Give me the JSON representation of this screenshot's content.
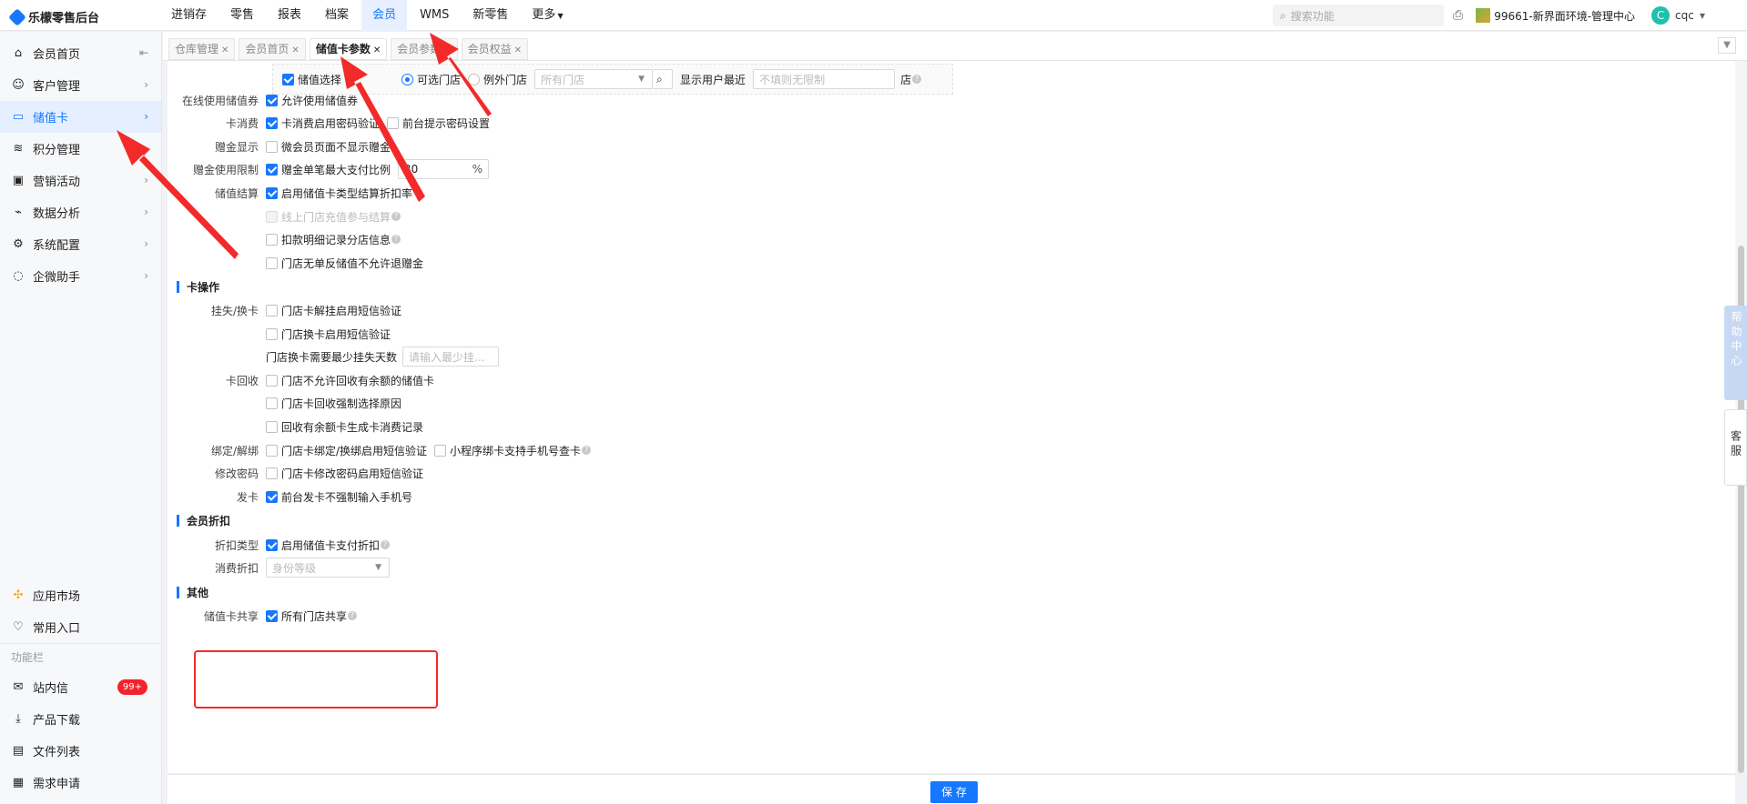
{
  "app": {
    "title": "乐檬零售后台"
  },
  "topnav": {
    "items": [
      "进销存",
      "零售",
      "报表",
      "档案",
      "会员",
      "WMS",
      "新零售",
      "更多"
    ],
    "active": "会员",
    "search_placeholder": "搜索功能",
    "store": "99661-新界面环境-管理中心",
    "user_initial": "C",
    "user": "cqc"
  },
  "sidebar": {
    "items": [
      {
        "label": "会员首页",
        "icon": "home-icon"
      },
      {
        "label": "客户管理",
        "icon": "user-icon"
      },
      {
        "label": "储值卡",
        "icon": "card-icon",
        "active": true
      },
      {
        "label": "积分管理",
        "icon": "database-icon"
      },
      {
        "label": "营销活动",
        "icon": "campaign-icon"
      },
      {
        "label": "数据分析",
        "icon": "chart-icon"
      },
      {
        "label": "系统配置",
        "icon": "gear-icon"
      },
      {
        "label": "企微助手",
        "icon": "chat-icon"
      }
    ],
    "bottom_items": [
      {
        "label": "应用市场",
        "icon": "app-market-icon"
      },
      {
        "label": "常用入口",
        "icon": "heart-icon"
      }
    ],
    "section_title": "功能栏",
    "tool_items": [
      {
        "label": "站内信",
        "icon": "mail-icon",
        "badge": "99+"
      },
      {
        "label": "产品下载",
        "icon": "download-icon"
      },
      {
        "label": "文件列表",
        "icon": "file-icon"
      },
      {
        "label": "需求申请",
        "icon": "request-icon"
      }
    ]
  },
  "tabs": [
    {
      "label": "仓库管理",
      "active": false
    },
    {
      "label": "会员首页",
      "active": false
    },
    {
      "label": "储值卡参数",
      "active": true
    },
    {
      "label": "会员参数",
      "active": false
    },
    {
      "label": "会员权益",
      "active": false
    }
  ],
  "form": {
    "top_row": {
      "checkbox_label": "储值选择",
      "radio1": "可选门店",
      "radio2": "例外门店",
      "store_select_placeholder": "所有门店",
      "recent_label": "显示用户最近",
      "recent_placeholder": "不填则无限制",
      "suffix": "店"
    },
    "online_coupon": {
      "label": "在线使用储值券",
      "option": "允许使用储值券"
    },
    "card_consume": {
      "label": "卡消费",
      "option1": "卡消费启用密码验证",
      "option2": "前台提示密码设置"
    },
    "gift_display": {
      "label": "赠金显示",
      "option": "微会员页面不显示赠金"
    },
    "gift_limit": {
      "label": "赠金使用限制",
      "option": "赠金单笔最大支付比例",
      "value": "30",
      "unit": "%"
    },
    "settle": {
      "label": "储值结算",
      "option1": "启用储值卡类型结算折扣率",
      "option2": "线上门店充值参与结算",
      "option3": "扣款明细记录分店信息",
      "option4": "门店无单反储值不允许退赠金"
    },
    "card_ops": {
      "title": "卡操作",
      "loss": {
        "label": "挂失/换卡",
        "option1": "门店卡解挂启用短信验证",
        "option2": "门店换卡启用短信验证",
        "days_label": "门店换卡需要最少挂失天数",
        "days_placeholder": "请输入最少挂..."
      },
      "recycle": {
        "label": "卡回收",
        "option1": "门店不允许回收有余额的储值卡",
        "option2": "门店卡回收强制选择原因",
        "option3": "回收有余额卡生成卡消费记录"
      },
      "bind": {
        "label": "绑定/解绑",
        "option1": "门店卡绑定/换绑启用短信验证",
        "option2": "小程序绑卡支持手机号查卡"
      },
      "pwd": {
        "label": "修改密码",
        "option": "门店卡修改密码启用短信验证"
      },
      "issue": {
        "label": "发卡",
        "option": "前台发卡不强制输入手机号"
      }
    },
    "discount": {
      "title": "会员折扣",
      "type": {
        "label": "折扣类型",
        "option": "启用储值卡支付折扣"
      },
      "consume": {
        "label": "消费折扣",
        "placeholder": "身份等级"
      }
    },
    "other": {
      "title": "其他",
      "share": {
        "label": "储值卡共享",
        "option": "所有门店共享"
      }
    }
  },
  "save_button": "保 存",
  "float": {
    "help": "帮助中心",
    "service": "客服"
  },
  "colors": {
    "accent": "#1677ff",
    "annotation": "#f22a2a",
    "badge": "#f5222d"
  }
}
